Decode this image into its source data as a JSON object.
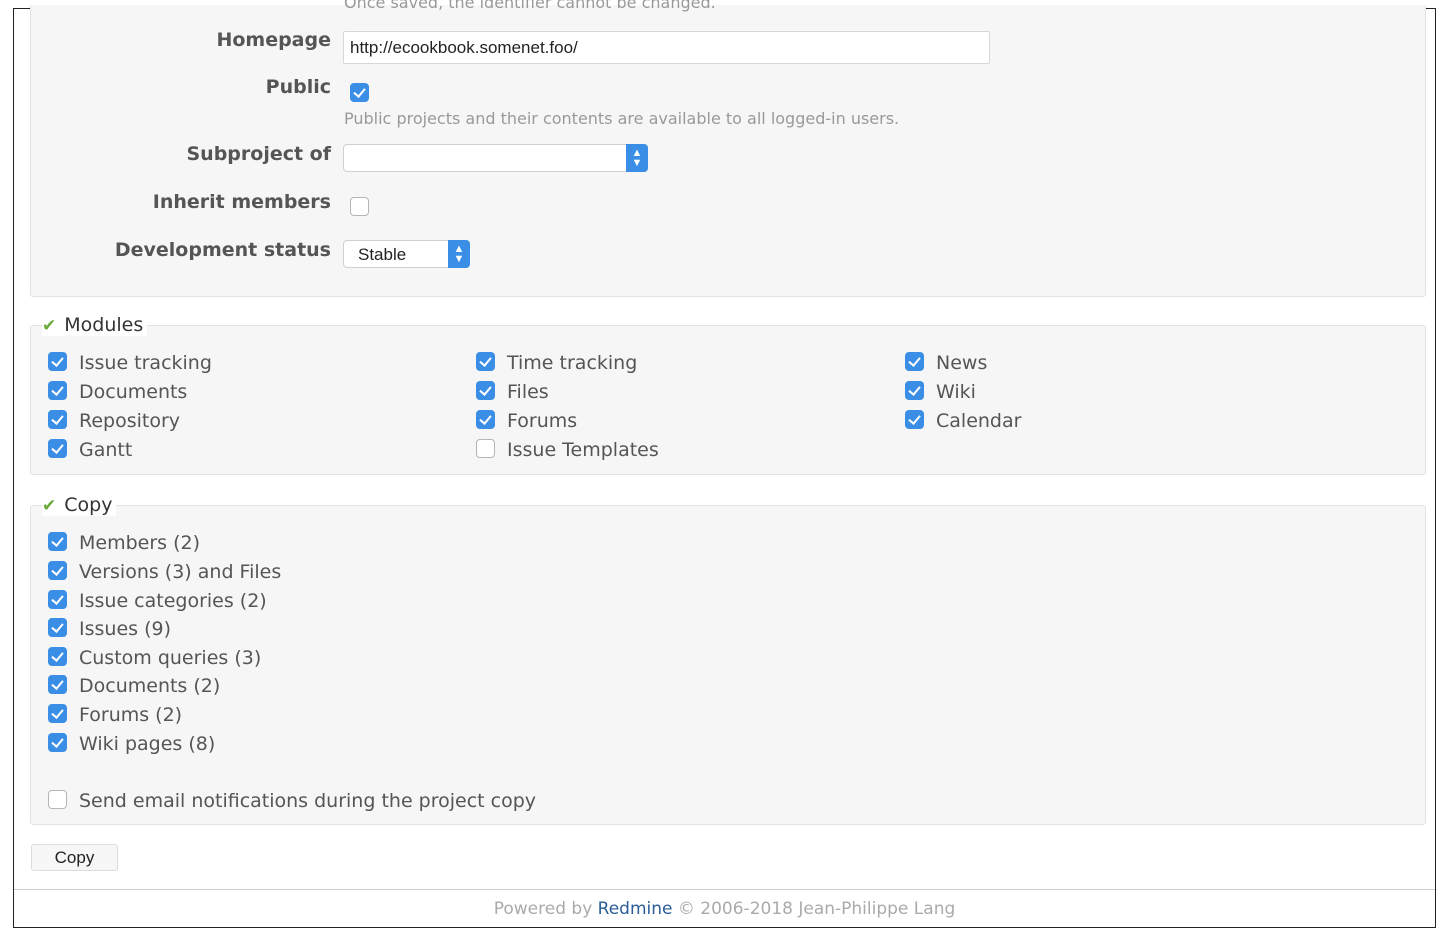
{
  "project_form": {
    "identifier_note": "Once saved, the identifier cannot be changed.",
    "homepage_label": "Homepage",
    "homepage_value": "http://ecookbook.somenet.foo/",
    "public_label": "Public",
    "public_checked": true,
    "public_hint": "Public projects and their contents are available to all logged-in users.",
    "subproject_label": "Subproject of",
    "subproject_value": "",
    "inherit_label": "Inherit members",
    "inherit_checked": false,
    "devstatus_label": "Development status",
    "devstatus_value": "Stable"
  },
  "modules": {
    "legend": "Modules",
    "columns": [
      [
        {
          "label": "Issue tracking",
          "checked": true
        },
        {
          "label": "Documents",
          "checked": true
        },
        {
          "label": "Repository",
          "checked": true
        },
        {
          "label": "Gantt",
          "checked": true
        }
      ],
      [
        {
          "label": "Time tracking",
          "checked": true
        },
        {
          "label": "Files",
          "checked": true
        },
        {
          "label": "Forums",
          "checked": true
        },
        {
          "label": "Issue Templates",
          "checked": false
        }
      ],
      [
        {
          "label": "News",
          "checked": true
        },
        {
          "label": "Wiki",
          "checked": true
        },
        {
          "label": "Calendar",
          "checked": true
        }
      ]
    ]
  },
  "copy": {
    "legend": "Copy",
    "items": [
      {
        "label": "Members (2)",
        "checked": true
      },
      {
        "label": "Versions (3) and Files",
        "checked": true
      },
      {
        "label": "Issue categories (2)",
        "checked": true
      },
      {
        "label": "Issues (9)",
        "checked": true
      },
      {
        "label": "Custom queries (3)",
        "checked": true
      },
      {
        "label": "Documents (2)",
        "checked": true
      },
      {
        "label": "Forums (2)",
        "checked": true
      },
      {
        "label": "Wiki pages (8)",
        "checked": true
      }
    ],
    "notify_label": "Send email notifications during the project copy",
    "notify_checked": false,
    "button_label": "Copy"
  },
  "footer": {
    "prefix": "Powered by",
    "link": "Redmine",
    "suffix": "© 2006-2018 Jean-Philippe Lang"
  },
  "colors": {
    "checkbox_accent": "#3a8ee6",
    "legend_check": "#6aaa3a",
    "link": "#2a5d96"
  }
}
